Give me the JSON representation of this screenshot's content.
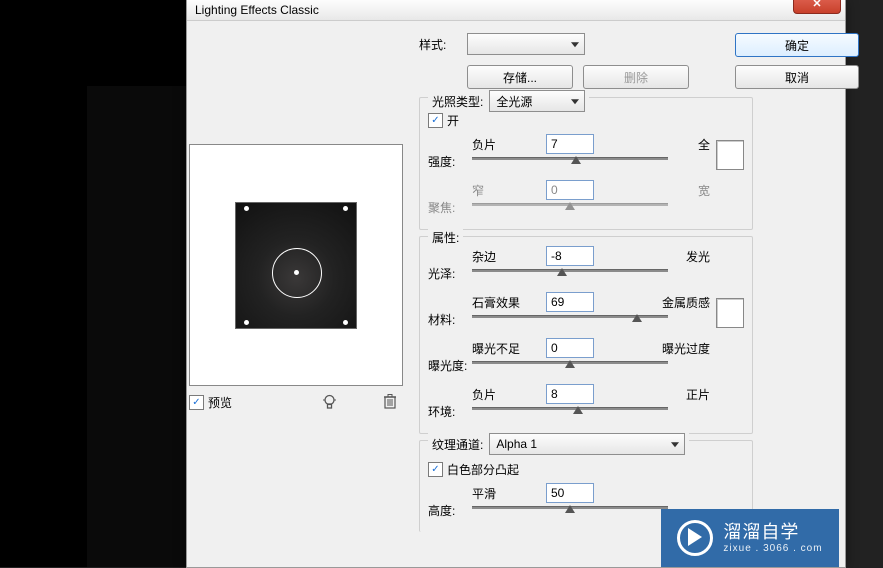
{
  "titlebar": {
    "title": "Lighting Effects Classic",
    "close_icon": "✕"
  },
  "buttons": {
    "ok": "确定",
    "cancel": "取消",
    "save": "存储...",
    "delete": "删除"
  },
  "labels": {
    "style": "样式:",
    "light_type": "光照类型:",
    "on": "开",
    "intensity": "强度:",
    "focus": "聚焦:",
    "properties": "属性:",
    "gloss": "光泽:",
    "material": "材料:",
    "exposure": "曝光度:",
    "ambience": "环境:",
    "texture_channel": "纹理通道:",
    "white_high": "白色部分凸起",
    "height": "高度:",
    "preview": "预览",
    "negative": "负片",
    "full": "全",
    "narrow": "窄",
    "wide": "宽",
    "matte": "杂边",
    "shiny": "发光",
    "plastic": "石膏效果",
    "metallic": "金属质感",
    "under": "曝光不足",
    "over": "曝光过度",
    "positive": "正片",
    "flat": "平滑"
  },
  "dropdowns": {
    "style": "",
    "light_type": "全光源",
    "texture_channel": "Alpha 1"
  },
  "values": {
    "intensity": "7",
    "focus": "0",
    "gloss": "-8",
    "material": "69",
    "exposure": "0",
    "ambience": "8",
    "height": "50"
  },
  "thumbs": {
    "intensity": 53,
    "focus": 50,
    "gloss": 46,
    "material": 84,
    "exposure": 50,
    "ambience": 54,
    "height": 50
  },
  "checkboxes": {
    "preview": true,
    "on": true,
    "white_high": true
  },
  "watermark": {
    "brand": "溜溜自学",
    "sub": "zixue . 3066 . com"
  },
  "chart_data": {
    "type": "table",
    "title": "Lighting Effects Classic parameters",
    "rows": [
      {
        "param": "强度",
        "left": "负片",
        "right": "全",
        "value": 7
      },
      {
        "param": "聚焦",
        "left": "窄",
        "right": "宽",
        "value": 0
      },
      {
        "param": "光泽",
        "left": "杂边",
        "right": "发光",
        "value": -8
      },
      {
        "param": "材料",
        "left": "石膏效果",
        "right": "金属质感",
        "value": 69
      },
      {
        "param": "曝光度",
        "left": "曝光不足",
        "right": "曝光过度",
        "value": 0
      },
      {
        "param": "环境",
        "left": "负片",
        "right": "正片",
        "value": 8
      },
      {
        "param": "高度",
        "left": "平滑",
        "right": "",
        "value": 50
      }
    ]
  }
}
